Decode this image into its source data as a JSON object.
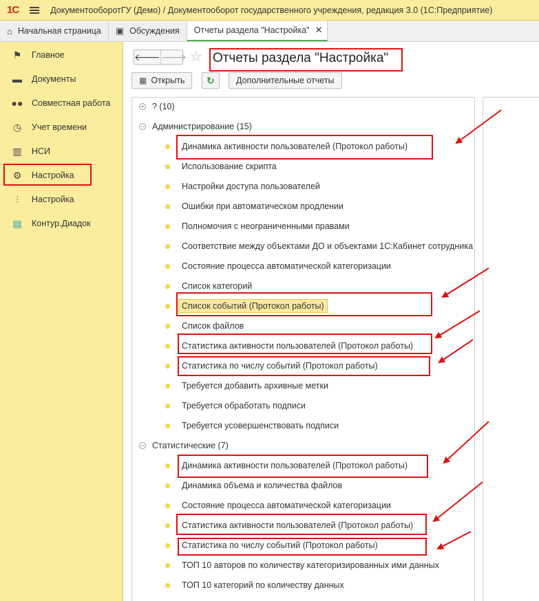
{
  "titlebar": {
    "logo": "1С",
    "title": "ДокументооборотГУ (Демо) / Документооборот государственного учреждения, редакция 3.0  (1С:Предприятие)"
  },
  "tabs": [
    {
      "label": "Начальная страница",
      "icon": "home-icon"
    },
    {
      "label": "Обсуждения",
      "icon": "chat-icon"
    },
    {
      "label": "Отчеты раздела \"Настройка\"",
      "icon": "",
      "close": "✕"
    }
  ],
  "sidebar": {
    "items": [
      {
        "label": "Главное",
        "icon": "flag-icon"
      },
      {
        "label": "Документы",
        "icon": "folder-icon"
      },
      {
        "label": "Совместная работа",
        "icon": "users-icon"
      },
      {
        "label": "Учет времени",
        "icon": "clock-icon"
      },
      {
        "label": "НСИ",
        "icon": "reference-icon"
      },
      {
        "label": "Настройка",
        "icon": "gear-icon"
      },
      {
        "label": "Настройка",
        "icon": "sliders-icon"
      },
      {
        "label": "Контур.Диадок",
        "icon": "diadoc-icon"
      }
    ]
  },
  "form": {
    "title": "Отчеты раздела \"Настройка\"",
    "open_label": "Открыть",
    "extra_reports_label": "Дополнительные отчеты"
  },
  "groups": {
    "g0": "? (10)",
    "g1": "Администрирование (15)",
    "g2": "Статистические (7)"
  },
  "admin_items": [
    "Динамика активности пользователей (Протокол работы)",
    "Использование скрипта",
    "Настройки доступа пользователей",
    "Ошибки при автоматическом продлении",
    "Полномочия с неограниченными правами",
    "Соответствие между объектами ДО и объектами 1С:Кабинет сотрудника",
    "Состояние процесса автоматической категоризации",
    "Список категорий",
    "Список событий (Протокол работы)",
    "Список файлов",
    "Статистика активности пользователей (Протокол работы)",
    "Статистика по числу событий (Протокол работы)",
    "Требуется добавить архивные метки",
    "Требуется обработать подписи",
    "Требуется усовершенствовать подписи"
  ],
  "stat_items": [
    "Динамика активности пользователей (Протокол работы)",
    "Динамика объема и количества файлов",
    "Состояние процесса автоматической категоризации",
    "Статистика активности пользователей (Протокол работы)",
    "Статистика по числу событий (Протокол работы)",
    "ТОП 10 авторов по количеству категоризированных ими данных",
    "ТОП 10 категорий по количеству данных"
  ],
  "colors": {
    "sidebar_bg": "#fbed9e",
    "highlight": "#e01010",
    "bullet": "#f3d64a",
    "active_tab_underline": "#4caf50"
  }
}
